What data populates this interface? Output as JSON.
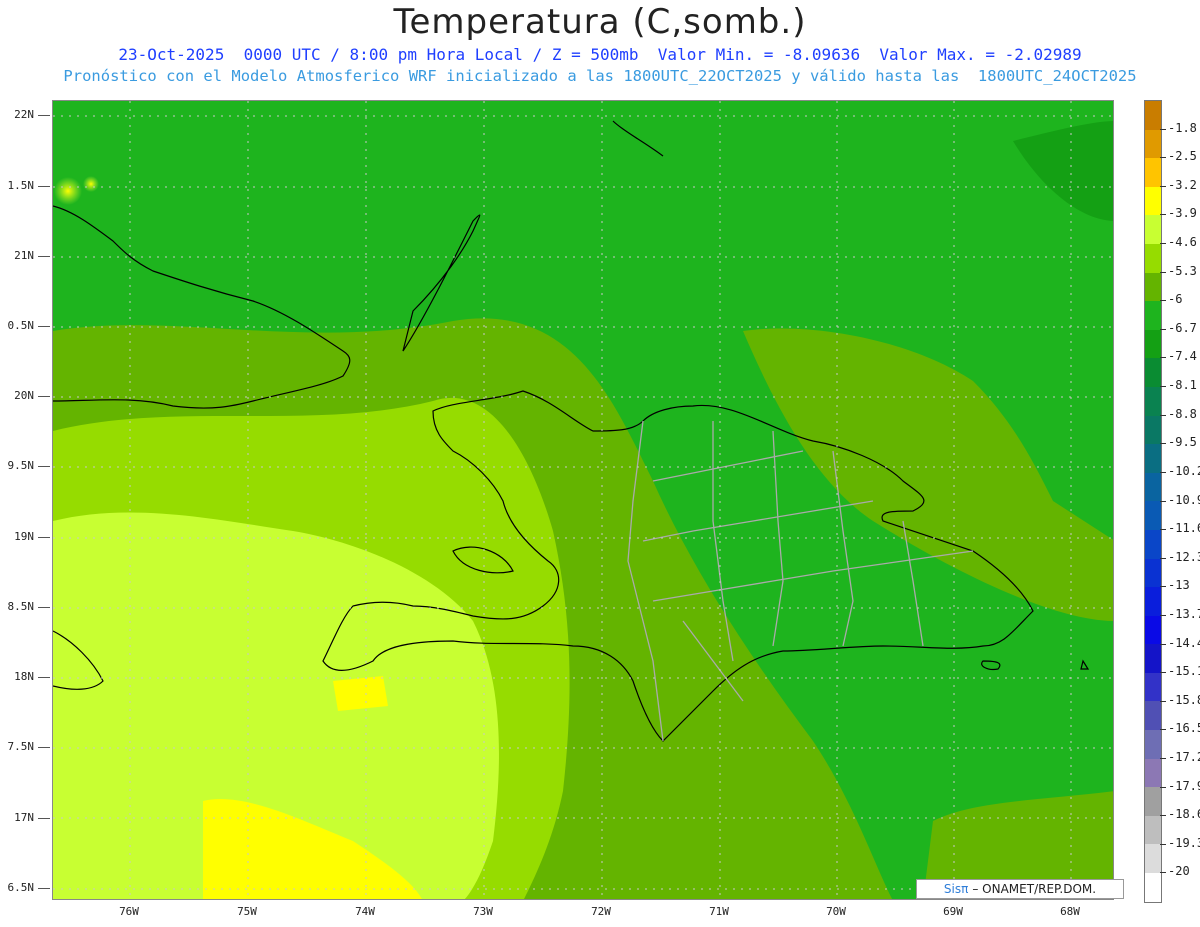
{
  "header": {
    "title": "Temperatura (C,somb.)",
    "line1": "23-Oct-2025  0000 UTC / 8:00 pm Hora Local / Z = 500mb  Valor Min. = -8.09636  Valor Max. = -2.02989",
    "line2": "Pronóstico con el Modelo Atmosferico WRF inicializado a las 1800UTC_22OCT2025 y válido hasta las  1800UTC_24OCT2025"
  },
  "axes": {
    "lat_labels": [
      "22N",
      "1.5N",
      "21N",
      "0.5N",
      "20N",
      "9.5N",
      "19N",
      "8.5N",
      "18N",
      "7.5N",
      "17N",
      "6.5N"
    ],
    "lon_labels": [
      "76W",
      "75W",
      "74W",
      "73W",
      "72W",
      "71W",
      "70W",
      "69W",
      "68W"
    ]
  },
  "colorbar": {
    "labels": [
      "-1.8",
      "-2.5",
      "-3.2",
      "-3.9",
      "-4.6",
      "-5.3",
      "-6",
      "-6.7",
      "-7.4",
      "-8.1",
      "-8.8",
      "-9.5",
      "-10.2",
      "-10.9",
      "-11.6",
      "-12.3",
      "-13",
      "-13.7",
      "-14.4",
      "-15.1",
      "-15.8",
      "-16.5",
      "-17.2",
      "-17.9",
      "-18.6",
      "-19.3",
      "-20"
    ],
    "colors": [
      "#c97d00",
      "#e09a00",
      "#ffc400",
      "#ffff00",
      "#c8ff32",
      "#96dc00",
      "#64b400",
      "#1eb41e",
      "#14a014",
      "#0a8c32",
      "#0a8250",
      "#0a7864",
      "#0a6e82",
      "#0a64a0",
      "#0a5ab4",
      "#0a46c8",
      "#0a32d2",
      "#0a1edc",
      "#0a0ae6",
      "#1414c8",
      "#3232c8",
      "#5050b4",
      "#6e6eb4",
      "#8c78b4",
      "#a0a0a0",
      "#bebebe",
      "#dcdcdc",
      "#ffffff"
    ]
  },
  "credit": {
    "brand": "Sisπ",
    "text": "– ONAMET/REP.DOM."
  }
}
